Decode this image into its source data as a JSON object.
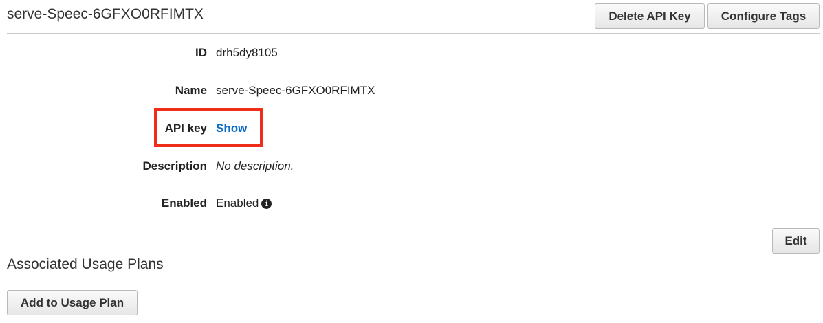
{
  "header": {
    "title": "serve-Speec-6GFXO0RFIMTX",
    "delete_label": "Delete API Key",
    "tags_label": "Configure Tags"
  },
  "details": {
    "id_label": "ID",
    "id_value": "drh5dy8105",
    "name_label": "Name",
    "name_value": "serve-Speec-6GFXO0RFIMTX",
    "key_label": "API key",
    "key_value": "Show",
    "desc_label": "Description",
    "desc_value": "No description.",
    "enabled_label": "Enabled",
    "enabled_value": "Enabled",
    "info_icon_glyph": "i",
    "edit_label": "Edit"
  },
  "plans": {
    "title": "Associated Usage Plans",
    "add_label": "Add to Usage Plan"
  },
  "colors": {
    "highlight": "#ef2e1a",
    "link": "#0b6cc8"
  },
  "icons": {
    "info": "info-circle-icon"
  }
}
